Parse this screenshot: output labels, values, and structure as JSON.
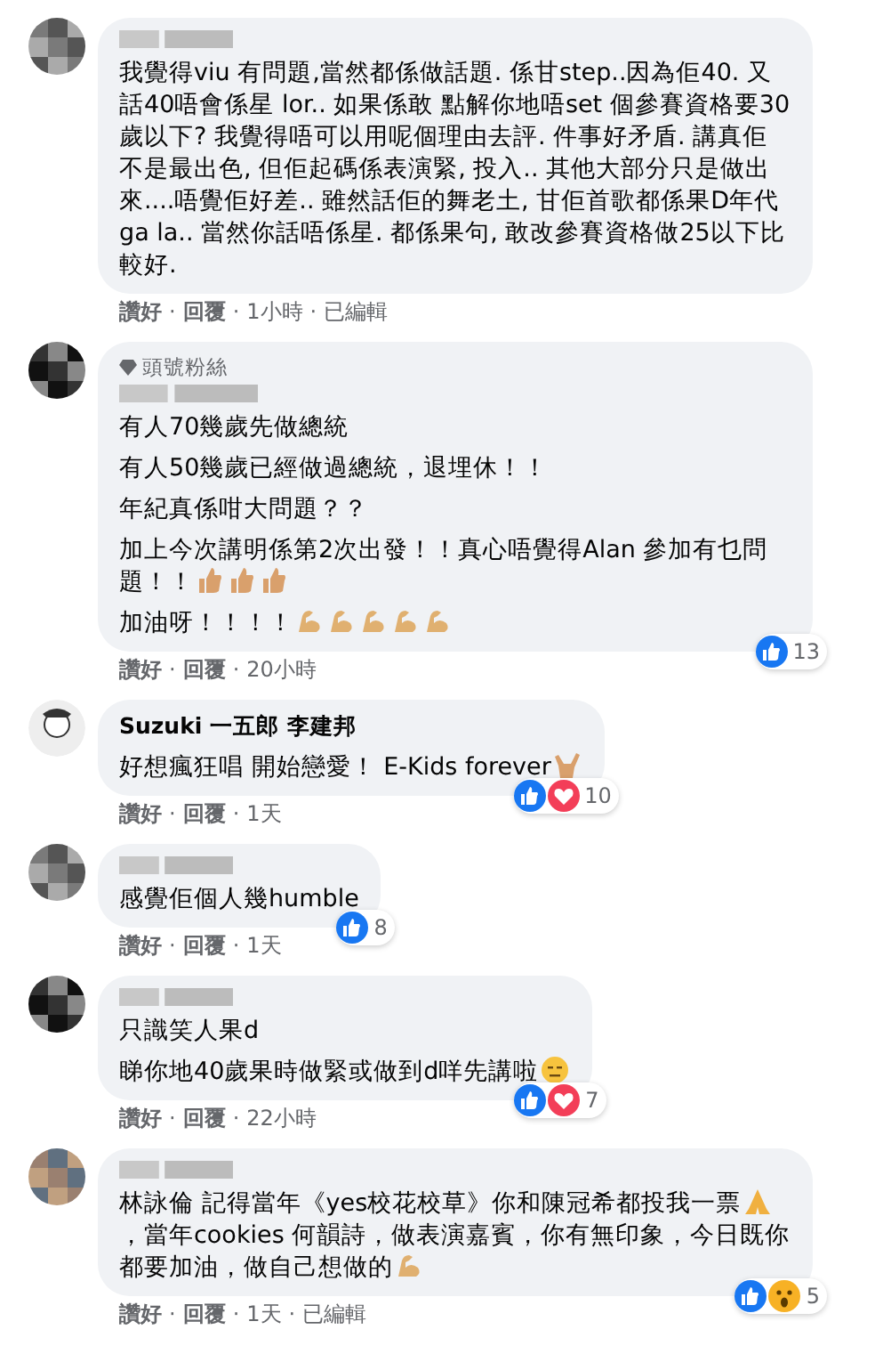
{
  "separator": "·",
  "comments": [
    {
      "avatar": {
        "kind": "blurred"
      },
      "paragraphs": [
        [
          {
            "kind": "text",
            "text": "我覺得viu 有問題,當然都係做話題. 係甘step..因為佢40. 又話40唔會係星 lor.. 如果係敢 點解你地唔set 個參賽資格要30歲以下? 我覺得唔可以用呢個理由去評. 件事好矛盾. 講真佢不是最出色, 但佢起碼係表演緊, 投入.. 其他大部分只是做出來....唔覺佢好差.. 雖然話佢的舞老土, 甘佢首歌都係果D年代ga la.. 當然你話唔係星. 都係果句, 敢改參賽資格做25以下比較好."
          }
        ]
      ],
      "meta": [
        "讚好",
        "回覆",
        "1小時",
        "已編輯"
      ]
    },
    {
      "avatar": {
        "kind": "blurred"
      },
      "badge": "頭號粉絲",
      "paragraphs": [
        [
          {
            "kind": "text",
            "text": "有人70幾歲先做總統"
          }
        ],
        [
          {
            "kind": "text",
            "text": "有人50幾歲已經做過總統，退埋休！！"
          }
        ],
        [
          {
            "kind": "text",
            "text": "年紀真係咁大問題？？"
          }
        ],
        [
          {
            "kind": "text",
            "text": "加上今次講明係第2次出發！！真心唔覺得Alan 參加有乜問題！！"
          },
          {
            "kind": "thumb"
          },
          {
            "kind": "thumb"
          },
          {
            "kind": "thumb"
          }
        ],
        [
          {
            "kind": "text",
            "text": "加油呀！！！！"
          },
          {
            "kind": "arm"
          },
          {
            "kind": "arm"
          },
          {
            "kind": "arm"
          },
          {
            "kind": "arm"
          },
          {
            "kind": "arm"
          }
        ]
      ],
      "reactions": {
        "icons": [
          {
            "kind": "like"
          }
        ],
        "count": "13"
      },
      "meta": [
        "讚好",
        "回覆",
        "20小時"
      ]
    },
    {
      "avatar": {
        "kind": "cartoon"
      },
      "author": "Suzuki 一五郎 李建邦",
      "paragraphs": [
        [
          {
            "kind": "text",
            "text": "好想瘋狂唱 開始戀愛！ E-Kids forever"
          },
          {
            "kind": "horns"
          }
        ]
      ],
      "reactions": {
        "icons": [
          {
            "kind": "like"
          },
          {
            "kind": "love"
          }
        ],
        "count": "10"
      },
      "meta": [
        "讚好",
        "回覆",
        "1天"
      ]
    },
    {
      "avatar": {
        "kind": "blurred"
      },
      "paragraphs": [
        [
          {
            "kind": "text",
            "text": "感覺佢個人幾humble"
          }
        ]
      ],
      "reactions": {
        "icons": [
          {
            "kind": "like"
          }
        ],
        "count": "8"
      },
      "meta": [
        "讚好",
        "回覆",
        "1天"
      ]
    },
    {
      "avatar": {
        "kind": "blurred"
      },
      "paragraphs": [
        [
          {
            "kind": "text",
            "text": "只識笑人果d"
          }
        ],
        [
          {
            "kind": "text",
            "text": "睇你地40歲果時做緊或做到d咩先講啦"
          },
          {
            "kind": "meh"
          }
        ]
      ],
      "reactions": {
        "icons": [
          {
            "kind": "like"
          },
          {
            "kind": "love"
          }
        ],
        "count": "7"
      },
      "meta": [
        "讚好",
        "回覆",
        "22小時"
      ]
    },
    {
      "avatar": {
        "kind": "blurred"
      },
      "paragraphs": [
        [
          {
            "kind": "text",
            "text": "林詠倫 記得當年《yes校花校草》你和陳冠希都投我一票"
          },
          {
            "kind": "pray"
          },
          {
            "kind": "text",
            "text": "，當年cookies 何韻詩，做表演嘉賓，你有無印象，今日既你都要加油，做自己想做的"
          },
          {
            "kind": "arm"
          }
        ]
      ],
      "reactions": {
        "icons": [
          {
            "kind": "like"
          },
          {
            "kind": "wow"
          }
        ],
        "count": "5"
      },
      "meta": [
        "讚好",
        "回覆",
        "1天",
        "已編輯"
      ]
    }
  ]
}
